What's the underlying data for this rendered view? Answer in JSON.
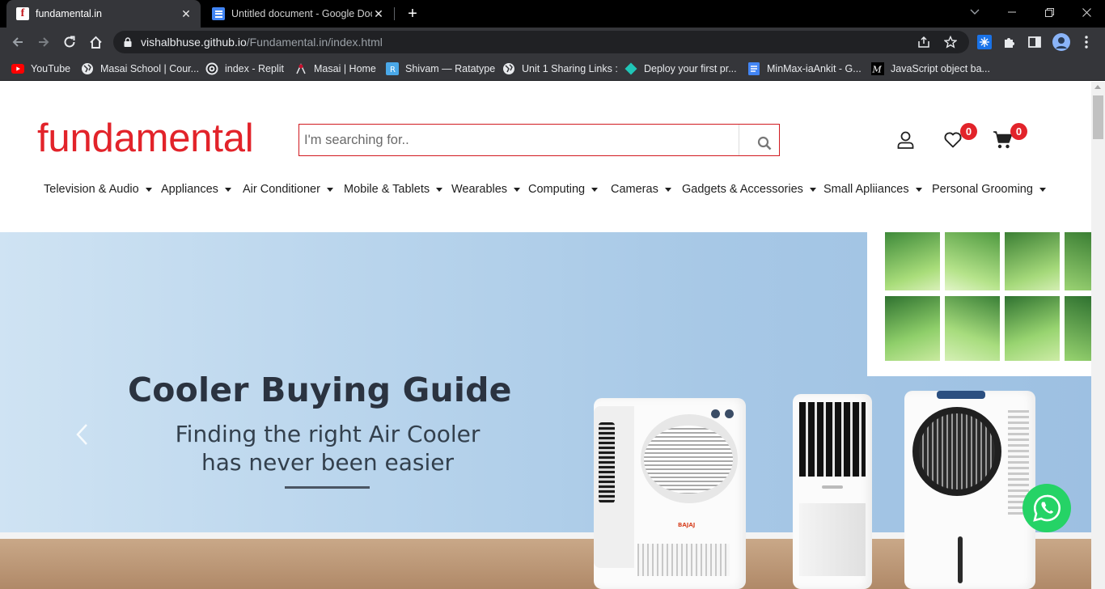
{
  "browser": {
    "tabs": [
      {
        "title": "fundamental.in",
        "favicon": "fundamental-favicon",
        "active": true
      },
      {
        "title": "Untitled document - Google Docs",
        "favicon": "google-docs-icon",
        "active": false
      }
    ],
    "url": {
      "host": "vishalbhuse.github.io",
      "path": "/Fundamental.in/index.html"
    },
    "bookmarks": [
      {
        "label": "YouTube",
        "icon": "youtube-icon"
      },
      {
        "label": "Masai School | Cour...",
        "icon": "globe-icon"
      },
      {
        "label": "index - Replit",
        "icon": "replit-icon"
      },
      {
        "label": "Masai | Home",
        "icon": "masai-icon"
      },
      {
        "label": "Shivam — Ratatype",
        "icon": "ratatype-icon"
      },
      {
        "label": "Unit 1 Sharing Links :",
        "icon": "globe-icon"
      },
      {
        "label": "Deploy your first pr...",
        "icon": "netlify-icon"
      },
      {
        "label": "MinMax-iaAnkit - G...",
        "icon": "google-docs-icon"
      },
      {
        "label": "JavaScript object ba...",
        "icon": "medium-icon"
      }
    ]
  },
  "site": {
    "logo": "fundamental",
    "search_placeholder": "I'm searching for..",
    "wishlist_count": "0",
    "cart_count": "0",
    "menu": [
      "Television & Audio",
      "Appliances",
      "Air Conditioner",
      "Mobile & Tablets",
      "Wearables",
      "Computing",
      "Cameras",
      "Gadgets & Accessories",
      "Small Apliiances",
      "Personal Grooming"
    ],
    "banner": {
      "title": "Cooler Buying Guide",
      "subtitle_line1": "Finding the right Air Cooler",
      "subtitle_line2": "has never been easier",
      "cooler_brand": "BAJAJ"
    }
  },
  "colors": {
    "brand_red": "#e2232a",
    "whatsapp_green": "#25d366",
    "chrome_dark": "#35363a"
  }
}
